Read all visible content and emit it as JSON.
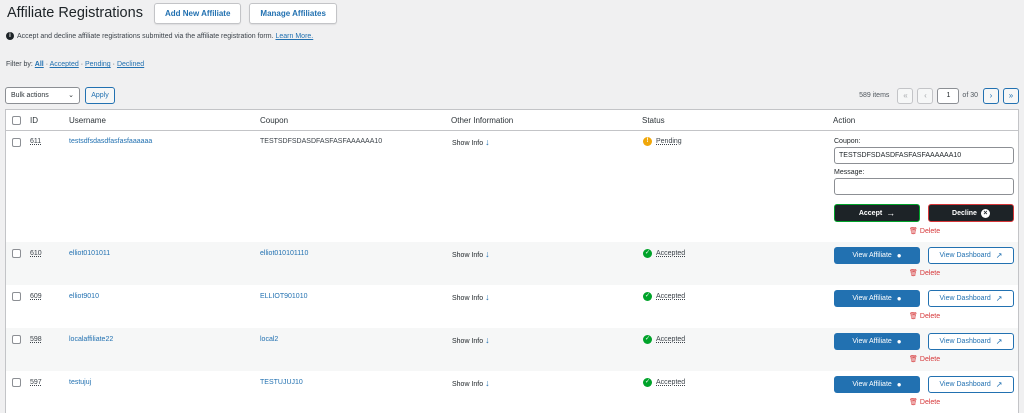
{
  "header": {
    "title": "Affiliate Registrations",
    "add_new_label": "Add New Affiliate",
    "manage_label": "Manage Affiliates"
  },
  "notice": {
    "text": "Accept and decline affiliate registrations submitted via the affiliate registration form.",
    "learn_more": "Learn More."
  },
  "filter": {
    "label": "Filter by:",
    "options": [
      "All",
      "Accepted",
      "Pending",
      "Declined"
    ],
    "separator": " · "
  },
  "tablenav": {
    "bulk_label": "Bulk actions",
    "apply_label": "Apply",
    "items_count": "589 items",
    "first": "«",
    "prev": "‹",
    "current_page": "1",
    "of_pages": "of 30",
    "next": "›",
    "last": "»"
  },
  "columns": [
    "ID",
    "Username",
    "Coupon",
    "Other Information",
    "Status",
    "Action"
  ],
  "pending_row": {
    "id": "611",
    "username": "testsdfsdasdfasfasfaaaaaa",
    "coupon": "TESTSDFSDASDFASFASFAAAAAA10",
    "info": "Show Info",
    "status": "Pending",
    "coupon_label": "Coupon:",
    "coupon_value": "TESTSDFSDASDFASFASFAAAAAA10",
    "message_label": "Message:",
    "message_value": "",
    "accept_label": "Accept",
    "decline_label": "Decline",
    "delete_label": "Delete"
  },
  "rows": [
    {
      "id": "610",
      "username": "elliot0101011",
      "coupon": "elliot010101110",
      "info": "Show Info",
      "status": "Accepted"
    },
    {
      "id": "609",
      "username": "elliot9010",
      "coupon": "ELLIOT901010",
      "info": "Show Info",
      "status": "Accepted"
    },
    {
      "id": "598",
      "username": "localaffiliate22",
      "coupon": "local2",
      "info": "Show Info",
      "status": "Accepted"
    },
    {
      "id": "597",
      "username": "testujuj",
      "coupon": "TESTUJUJ10",
      "info": "Show Info",
      "status": "Accepted"
    }
  ],
  "row_actions": {
    "view_affiliate": "View Affiliate",
    "view_dashboard": "View Dashboard",
    "delete": "Delete"
  },
  "colors": {
    "link": "#2271b1",
    "pending": "#f0a70a",
    "accepted": "#00a32a",
    "danger": "#d63638"
  },
  "icons": {
    "info": "info-icon",
    "pending": "warning-icon",
    "accepted": "check-circle-icon",
    "accept": "arrow-right-icon",
    "decline": "close-circle-icon",
    "trash": "trash-icon",
    "user": "user-icon",
    "external": "external-link-icon"
  }
}
